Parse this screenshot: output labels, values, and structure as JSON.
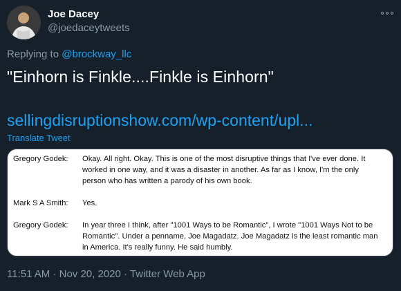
{
  "user": {
    "display_name": "Joe Dacey",
    "handle": "@joedaceytweets"
  },
  "reply": {
    "prefix": "Replying to",
    "to": "@brockway_llc"
  },
  "tweet": {
    "text": "\"Einhorn is Finkle....Finkle is Einhorn\"",
    "link": "sellingdisruptionshow.com/wp-content/upl...",
    "translate": "Translate Tweet"
  },
  "transcript": [
    {
      "speaker": "Gregory Godek:",
      "text": "Okay. All right. Okay. This is one of the most disruptive things that I've ever done. It worked in one way, and it was a disaster in another. As far as I know, I'm the only person who has written a parody of his own book."
    },
    {
      "speaker": "Mark S A Smith:",
      "text": "Yes."
    },
    {
      "speaker": "Gregory Godek:",
      "text": "In year three I think, after \"1001 Ways to be Romantic\", I wrote \"1001 Ways Not to be Romantic\". Under a penname, Joe Magadatz. Joe Magadatz is the least romantic man in America. It's really funny. He said humbly."
    }
  ],
  "meta": {
    "time": "11:51 AM",
    "sep1": " · ",
    "date": "Nov 20, 2020",
    "sep2": " · ",
    "source": "Twitter Web App"
  },
  "icons": {
    "more": "more-icon"
  }
}
